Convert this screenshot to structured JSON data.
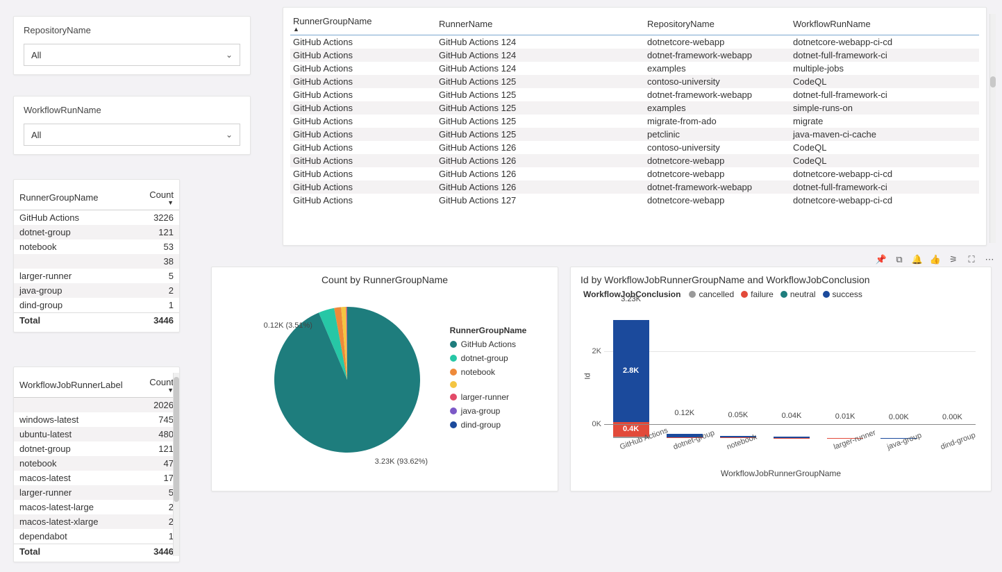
{
  "filters": {
    "repo": {
      "label": "RepositoryName",
      "value": "All"
    },
    "wf": {
      "label": "WorkflowRunName",
      "value": "All"
    }
  },
  "groupTable": {
    "headers": [
      "RunnerGroupName",
      "Count"
    ],
    "rows": [
      {
        "name": "GitHub Actions",
        "count": 3226
      },
      {
        "name": "dotnet-group",
        "count": 121
      },
      {
        "name": "notebook",
        "count": 53
      },
      {
        "name": "",
        "count": 38
      },
      {
        "name": "larger-runner",
        "count": 5
      },
      {
        "name": "java-group",
        "count": 2
      },
      {
        "name": "dind-group",
        "count": 1
      }
    ],
    "totalLabel": "Total",
    "total": 3446
  },
  "labelTable": {
    "headers": [
      "WorkflowJobRunnerLabel",
      "Count"
    ],
    "rows": [
      {
        "name": "",
        "count": 2026
      },
      {
        "name": "windows-latest",
        "count": 745
      },
      {
        "name": "ubuntu-latest",
        "count": 480
      },
      {
        "name": "dotnet-group",
        "count": 121
      },
      {
        "name": "notebook",
        "count": 47
      },
      {
        "name": "macos-latest",
        "count": 17
      },
      {
        "name": "larger-runner",
        "count": 5
      },
      {
        "name": "macos-latest-large",
        "count": 2
      },
      {
        "name": "macos-latest-xlarge",
        "count": 2
      },
      {
        "name": "dependabot",
        "count": 1
      }
    ],
    "totalLabel": "Total",
    "total": 3446
  },
  "bigTable": {
    "headers": [
      "RunnerGroupName",
      "RunnerName",
      "RepositoryName",
      "WorkflowRunName"
    ],
    "sortAsc": true,
    "rows": [
      {
        "g": "GitHub Actions",
        "r": "GitHub Actions 124",
        "repo": "dotnetcore-webapp",
        "wf": "dotnetcore-webapp-ci-cd"
      },
      {
        "g": "GitHub Actions",
        "r": "GitHub Actions 124",
        "repo": "dotnet-framework-webapp",
        "wf": "dotnet-full-framework-ci"
      },
      {
        "g": "GitHub Actions",
        "r": "GitHub Actions 124",
        "repo": "examples",
        "wf": "multiple-jobs"
      },
      {
        "g": "GitHub Actions",
        "r": "GitHub Actions 125",
        "repo": "contoso-university",
        "wf": "CodeQL"
      },
      {
        "g": "GitHub Actions",
        "r": "GitHub Actions 125",
        "repo": "dotnet-framework-webapp",
        "wf": "dotnet-full-framework-ci"
      },
      {
        "g": "GitHub Actions",
        "r": "GitHub Actions 125",
        "repo": "examples",
        "wf": "simple-runs-on"
      },
      {
        "g": "GitHub Actions",
        "r": "GitHub Actions 125",
        "repo": "migrate-from-ado",
        "wf": "migrate"
      },
      {
        "g": "GitHub Actions",
        "r": "GitHub Actions 125",
        "repo": "petclinic",
        "wf": "java-maven-ci-cache"
      },
      {
        "g": "GitHub Actions",
        "r": "GitHub Actions 126",
        "repo": "contoso-university",
        "wf": "CodeQL"
      },
      {
        "g": "GitHub Actions",
        "r": "GitHub Actions 126",
        "repo": "dotnetcore-webapp",
        "wf": "CodeQL"
      },
      {
        "g": "GitHub Actions",
        "r": "GitHub Actions 126",
        "repo": "dotnetcore-webapp",
        "wf": "dotnetcore-webapp-ci-cd"
      },
      {
        "g": "GitHub Actions",
        "r": "GitHub Actions 126",
        "repo": "dotnet-framework-webapp",
        "wf": "dotnet-full-framework-ci"
      },
      {
        "g": "GitHub Actions",
        "r": "GitHub Actions 127",
        "repo": "dotnetcore-webapp",
        "wf": "dotnetcore-webapp-ci-cd"
      }
    ]
  },
  "chart_data": [
    {
      "type": "pie",
      "title": "Count by RunnerGroupName",
      "legend_title": "RunnerGroupName",
      "series": [
        {
          "name": "GitHub Actions",
          "value": 3226,
          "pct": 93.62,
          "label": "3.23K (93.62%)",
          "color": "#1e7d7d"
        },
        {
          "name": "dotnet-group",
          "value": 121,
          "pct": 3.51,
          "label": "0.12K (3.51%)",
          "color": "#27c7a6"
        },
        {
          "name": "notebook",
          "value": 53,
          "pct": 1.54,
          "color": "#ee8a3a"
        },
        {
          "name": "",
          "value": 38,
          "pct": 1.1,
          "color": "#f4c542"
        },
        {
          "name": "larger-runner",
          "value": 5,
          "pct": 0.15,
          "color": "#e24a68"
        },
        {
          "name": "java-group",
          "value": 2,
          "pct": 0.06,
          "color": "#7c59c7"
        },
        {
          "name": "dind-group",
          "value": 1,
          "pct": 0.03,
          "color": "#1b4a9c"
        }
      ]
    },
    {
      "type": "bar-stacked",
      "title": "Id by WorkflowJobRunnerGroupName and WorkflowJobConclusion",
      "legend_title": "WorkflowJobConclusion",
      "legend": [
        {
          "name": "cancelled",
          "color": "#9a9a9a"
        },
        {
          "name": "failure",
          "color": "#e24a3a"
        },
        {
          "name": "neutral",
          "color": "#1e7d7d"
        },
        {
          "name": "success",
          "color": "#1b4a9c"
        }
      ],
      "ylabel": "Id",
      "xlabel": "WorkflowJobRunnerGroupName",
      "ylim": [
        0,
        3230
      ],
      "yticks": [
        0,
        2000
      ],
      "ytick_labels": [
        "0K",
        "2K"
      ],
      "categories": [
        "GitHub Actions",
        "dotnet-group",
        "notebook",
        "",
        "larger-runner",
        "java-group",
        "dind-group"
      ],
      "totals_label": [
        "3.23K",
        "0.12K",
        "0.05K",
        "0.04K",
        "0.01K",
        "0.00K",
        "0.00K"
      ],
      "series": [
        {
          "name": "cancelled",
          "values": [
            30,
            0,
            0,
            0,
            0,
            0,
            0
          ]
        },
        {
          "name": "failure",
          "values": [
            400,
            20,
            10,
            5,
            2,
            0,
            0
          ]
        },
        {
          "name": "neutral",
          "values": [
            0,
            0,
            0,
            0,
            0,
            0,
            0
          ]
        },
        {
          "name": "success",
          "values": [
            2800,
            100,
            40,
            35,
            8,
            2,
            1
          ]
        }
      ],
      "inner_labels": [
        {
          "cat": 0,
          "seg": "success",
          "text": "2.8K"
        },
        {
          "cat": 0,
          "seg": "failure",
          "text": "0.4K"
        }
      ]
    }
  ],
  "toolbar_icons": [
    "pin",
    "copy",
    "bell",
    "like",
    "filter",
    "focus",
    "more"
  ]
}
